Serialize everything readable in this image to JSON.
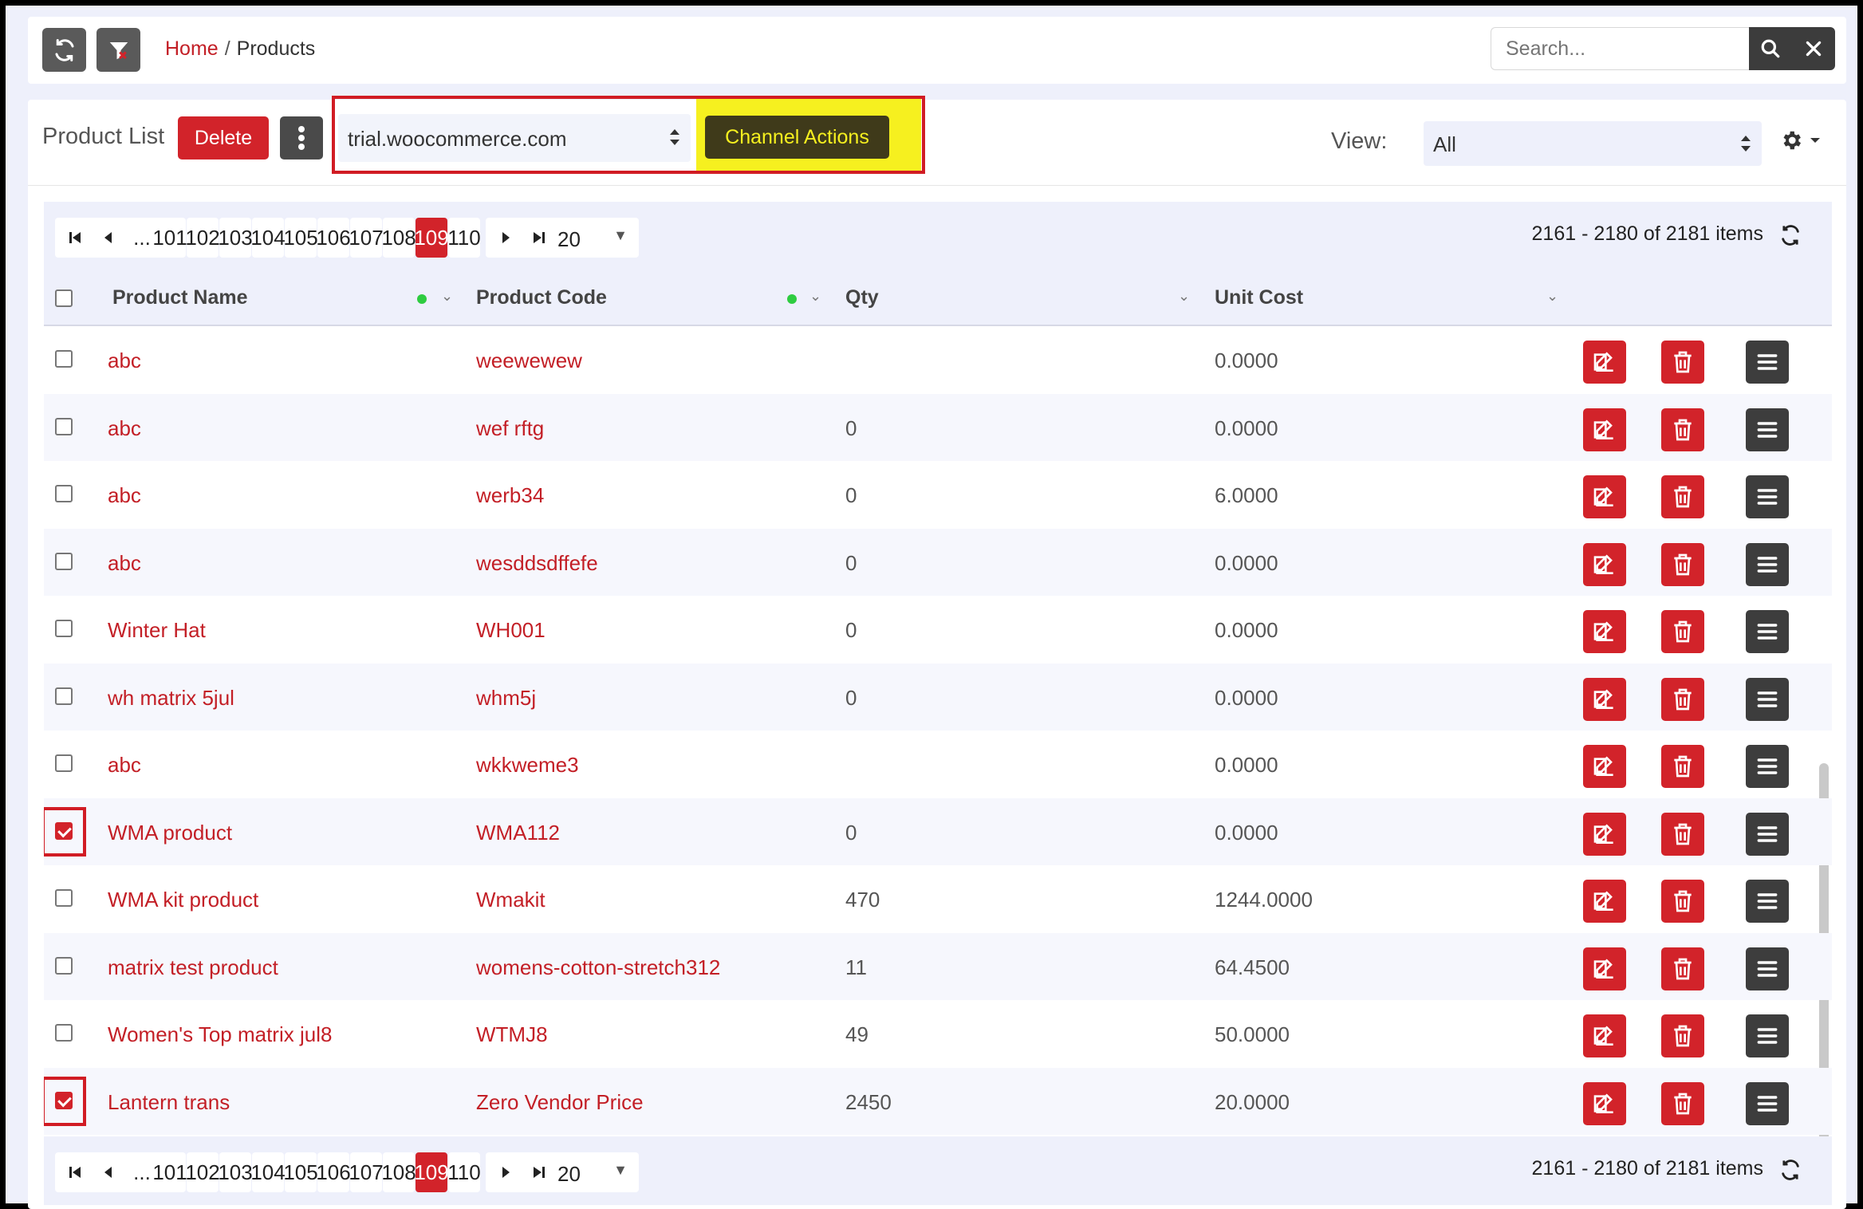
{
  "header": {
    "breadcrumb": {
      "home": "Home",
      "separator": "/",
      "current": "Products"
    },
    "search": {
      "placeholder": "Search..."
    },
    "icons": {
      "refresh": "refresh-icon",
      "filter": "filter-clear-icon",
      "search": "search-icon",
      "close": "close-icon"
    }
  },
  "toolbar": {
    "title": "Product List",
    "delete_label": "Delete",
    "channel_value": "trial.woocommerce.com",
    "channel_actions_label": "Channel Actions",
    "view_label": "View:",
    "view_value": "All"
  },
  "pager": {
    "ellipsis": "...",
    "pages": [
      "101",
      "102",
      "103",
      "104",
      "105",
      "106",
      "107",
      "108",
      "109",
      "110"
    ],
    "active_page": "109",
    "page_size": "20",
    "info": "2161 - 2180 of 2181 items"
  },
  "table": {
    "columns": {
      "name": "Product Name",
      "code": "Product Code",
      "qty": "Qty",
      "cost": "Unit Cost"
    },
    "rows": [
      {
        "name": "abc",
        "code": "weewewew",
        "qty": "",
        "cost": "0.0000",
        "checked": false
      },
      {
        "name": "abc",
        "code": "wef rftg",
        "qty": "0",
        "cost": "0.0000",
        "checked": false
      },
      {
        "name": "abc",
        "code": "werb34",
        "qty": "0",
        "cost": "6.0000",
        "checked": false
      },
      {
        "name": "abc",
        "code": "wesddsdffefe",
        "qty": "0",
        "cost": "0.0000",
        "checked": false
      },
      {
        "name": "Winter Hat",
        "code": "WH001",
        "qty": "0",
        "cost": "0.0000",
        "checked": false
      },
      {
        "name": "wh matrix 5jul",
        "code": "whm5j",
        "qty": "0",
        "cost": "0.0000",
        "checked": false
      },
      {
        "name": "abc",
        "code": "wkkweme3",
        "qty": "",
        "cost": "0.0000",
        "checked": false
      },
      {
        "name": "WMA product",
        "code": "WMA112",
        "qty": "0",
        "cost": "0.0000",
        "checked": true
      },
      {
        "name": "WMA kit product",
        "code": "Wmakit",
        "qty": "470",
        "cost": "1244.0000",
        "checked": false
      },
      {
        "name": "matrix test product",
        "code": "womens-cotton-stretch312",
        "qty": "11",
        "cost": "64.4500",
        "checked": false
      },
      {
        "name": "Women's Top matrix jul8",
        "code": "WTMJ8",
        "qty": "49",
        "cost": "50.0000",
        "checked": false
      },
      {
        "name": "Lantern trans",
        "code": "Zero Vendor Price",
        "qty": "2450",
        "cost": "20.0000",
        "checked": true
      }
    ]
  },
  "colors": {
    "accent": "#d2232a",
    "highlight": "#f6f01f",
    "dark": "#3d3d3d"
  }
}
